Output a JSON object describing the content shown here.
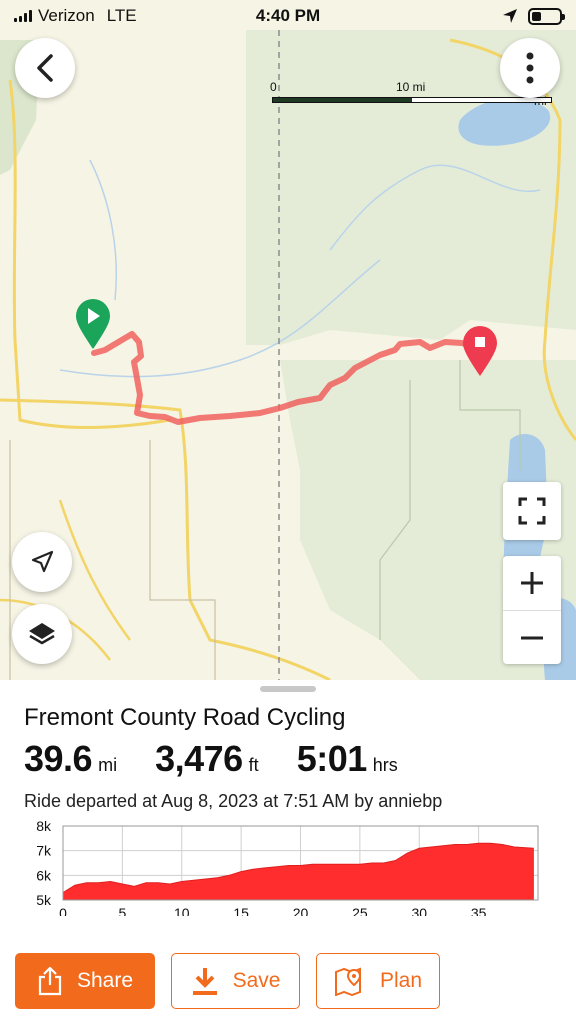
{
  "status_bar": {
    "carrier": "Verizon",
    "network": "LTE",
    "time": "4:40 PM"
  },
  "map": {
    "scale": {
      "start": "0",
      "mid": "10 mi",
      "end": "20 mi"
    },
    "route_color": "#f0625f",
    "start_marker_color": "#1aa55a",
    "end_marker_color": "#ef3b4f",
    "public_land_color": "#e4ecd8",
    "water_color": "#a9cbe8",
    "road_color": "#f2d467"
  },
  "ride": {
    "title": "Fremont County Road Cycling",
    "distance": {
      "value": "39.6",
      "unit": "mi"
    },
    "elevation": {
      "value": "3,476",
      "unit": "ft"
    },
    "duration": {
      "value": "5:01",
      "unit": "hrs"
    },
    "departed": "Ride departed at Aug 8, 2023 at 7:51 AM by anniebp"
  },
  "chart_data": {
    "type": "area",
    "xlabel": "",
    "ylabel": "",
    "x_ticks": [
      "0",
      "5",
      "10",
      "15",
      "20",
      "25",
      "30",
      "35"
    ],
    "y_ticks": [
      "5k",
      "6k",
      "7k",
      "8k"
    ],
    "xlim": [
      0,
      40
    ],
    "ylim": [
      5000,
      8000
    ],
    "grid": true,
    "fill_color": "#ff2d2d",
    "x": [
      0,
      1,
      2,
      3,
      4,
      5,
      6,
      7,
      8,
      9,
      10,
      11,
      12,
      13,
      14,
      15,
      16,
      17,
      18,
      19,
      20,
      21,
      22,
      23,
      24,
      25,
      26,
      27,
      28,
      29,
      30,
      31,
      32,
      33,
      34,
      35,
      36,
      37,
      38,
      39.6
    ],
    "y": [
      5300,
      5600,
      5700,
      5700,
      5750,
      5650,
      5550,
      5700,
      5700,
      5650,
      5750,
      5800,
      5850,
      5900,
      6000,
      6150,
      6250,
      6300,
      6350,
      6400,
      6400,
      6450,
      6450,
      6450,
      6450,
      6450,
      6500,
      6500,
      6600,
      6900,
      7100,
      7150,
      7200,
      7250,
      7250,
      7300,
      7300,
      7250,
      7150,
      7100
    ]
  },
  "actions": {
    "share": "Share",
    "save": "Save",
    "plan": "Plan"
  }
}
